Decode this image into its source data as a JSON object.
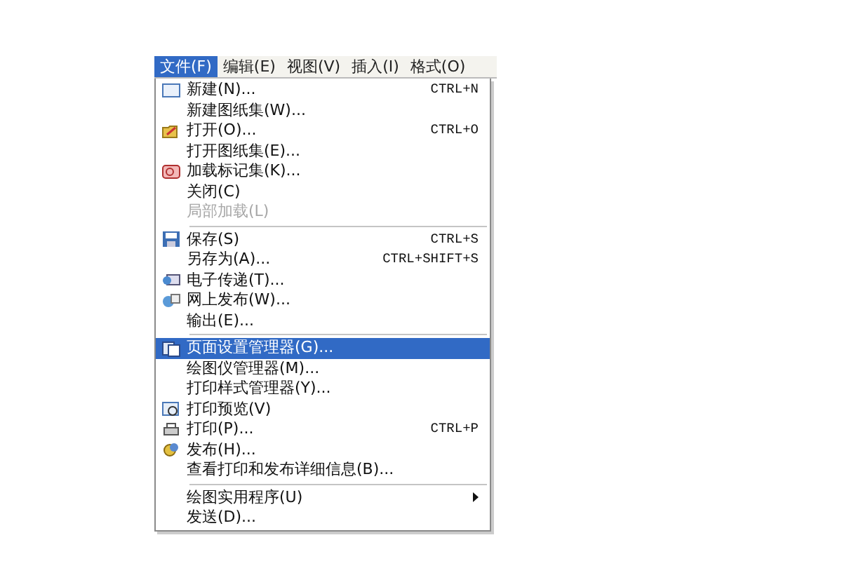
{
  "menu_bar": [
    {
      "label": "文件(F)",
      "selected": true
    },
    {
      "label": "编辑(E)",
      "selected": false
    },
    {
      "label": "视图(V)",
      "selected": false
    },
    {
      "label": "插入(I)",
      "selected": false
    },
    {
      "label": "格式(O)",
      "selected": false
    }
  ],
  "menu": [
    {
      "kind": "item",
      "label": "新建(N)...",
      "shortcut": "CTRL+N",
      "disabled": false,
      "selected": false
    },
    {
      "kind": "item",
      "label": "新建图纸集(W)...",
      "disabled": false,
      "selected": false
    },
    {
      "kind": "item",
      "label": "打开(O)...",
      "shortcut": "CTRL+O",
      "disabled": false,
      "selected": false
    },
    {
      "kind": "item",
      "label": "打开图纸集(E)...",
      "disabled": false,
      "selected": false
    },
    {
      "kind": "item",
      "label": "加载标记集(K)...",
      "disabled": false,
      "selected": false
    },
    {
      "kind": "item",
      "label": "关闭(C)",
      "disabled": false,
      "selected": false
    },
    {
      "kind": "item",
      "label": "局部加载(L)",
      "disabled": true,
      "selected": false
    },
    {
      "kind": "separator"
    },
    {
      "kind": "item",
      "label": "保存(S)",
      "shortcut": "CTRL+S",
      "disabled": false,
      "selected": false
    },
    {
      "kind": "item",
      "label": "另存为(A)...",
      "shortcut": "CTRL+SHIFT+S",
      "disabled": false,
      "selected": false
    },
    {
      "kind": "item",
      "label": "电子传递(T)...",
      "disabled": false,
      "selected": false
    },
    {
      "kind": "item",
      "label": "网上发布(W)...",
      "disabled": false,
      "selected": false
    },
    {
      "kind": "item",
      "label": "输出(E)...",
      "disabled": false,
      "selected": false
    },
    {
      "kind": "separator"
    },
    {
      "kind": "item",
      "label": "页面设置管理器(G)...",
      "disabled": false,
      "selected": true
    },
    {
      "kind": "item",
      "label": "绘图仪管理器(M)...",
      "disabled": false,
      "selected": false
    },
    {
      "kind": "item",
      "label": "打印样式管理器(Y)...",
      "disabled": false,
      "selected": false
    },
    {
      "kind": "item",
      "label": "打印预览(V)",
      "disabled": false,
      "selected": false
    },
    {
      "kind": "item",
      "label": "打印(P)...",
      "shortcut": "CTRL+P",
      "disabled": false,
      "selected": false
    },
    {
      "kind": "item",
      "label": "发布(H)...",
      "disabled": false,
      "selected": false
    },
    {
      "kind": "item",
      "label": "查看打印和发布详细信息(B)...",
      "disabled": false,
      "selected": false
    },
    {
      "kind": "separator"
    },
    {
      "kind": "item",
      "label": "绘图实用程序(U)",
      "submenu": true,
      "disabled": false,
      "selected": false
    },
    {
      "kind": "item",
      "label": "发送(D)...",
      "disabled": false,
      "selected": false
    }
  ]
}
